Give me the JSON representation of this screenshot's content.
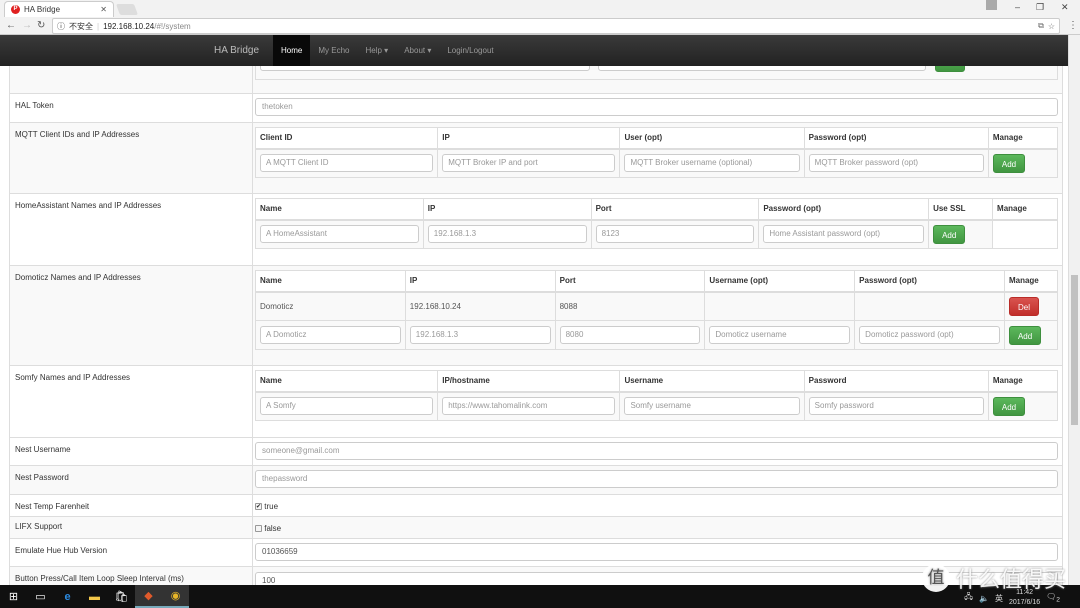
{
  "browser": {
    "tab_title": "HA Bridge",
    "security": "不安全",
    "url_host": "192.168.10.24",
    "url_path": "/#!/system"
  },
  "navbar": {
    "brand": "HA Bridge",
    "items": [
      "Home",
      "My Echo",
      "Help ▾",
      "About ▾",
      "Login/Logout"
    ],
    "active": "Home"
  },
  "settings": {
    "hal_token": {
      "label": "HAL Token",
      "placeholder": "thetoken"
    },
    "mqtt": {
      "label": "MQTT Client IDs and IP Addresses",
      "headers": [
        "Client ID",
        "IP",
        "User (opt)",
        "Password (opt)",
        "Manage"
      ],
      "placeholders": [
        "A MQTT Client ID",
        "MQTT Broker IP and port",
        "MQTT Broker username (optional)",
        "MQTT Broker password (opt)"
      ],
      "add": "Add"
    },
    "homeassistant": {
      "label": "HomeAssistant Names and IP Addresses",
      "headers": [
        "Name",
        "IP",
        "Port",
        "Password (opt)",
        "Use SSL",
        "Manage"
      ],
      "placeholders": [
        "A HomeAssistant",
        "192.168.1.3",
        "8123",
        "Home Assistant password (opt)"
      ],
      "use_ssl": false,
      "add": "Add"
    },
    "domoticz": {
      "label": "Domoticz Names and IP Addresses",
      "headers": [
        "Name",
        "IP",
        "Port",
        "Username (opt)",
        "Password (opt)",
        "Manage"
      ],
      "rows": [
        [
          "Domoticz",
          "192.168.10.24",
          "8088",
          "",
          ""
        ]
      ],
      "del": "Del",
      "placeholders": [
        "A Domoticz",
        "192.168.1.3",
        "8080",
        "Domoticz username",
        "Domoticz password (opt)"
      ],
      "add": "Add"
    },
    "somfy": {
      "label": "Somfy Names and IP Addresses",
      "headers": [
        "Name",
        "IP/hostname",
        "Username",
        "Password",
        "Manage"
      ],
      "placeholders": [
        "A Somfy",
        "https://www.tahomalink.com",
        "Somfy username",
        "Somfy password"
      ],
      "add": "Add"
    },
    "nest_username": {
      "label": "Nest Username",
      "placeholder": "someone@gmail.com"
    },
    "nest_password": {
      "label": "Nest Password",
      "placeholder": "thepassword"
    },
    "nest_temp_f": {
      "label": "Nest Temp Farenheit",
      "checked": true,
      "text": "true"
    },
    "lifx": {
      "label": "LIFX Support",
      "checked": false,
      "text": "false"
    },
    "hue_version": {
      "label": "Emulate Hue Hub Version",
      "value": "01036659"
    },
    "sleep_interval": {
      "label": "Button Press/Call Item Loop Sleep Interval (ms)",
      "value": "100"
    }
  },
  "tray": {
    "ime": "英",
    "time": "11:42",
    "date": "2017/6/16",
    "notifications": "2"
  },
  "watermark": {
    "text": "什么值得买",
    "mark": "值"
  }
}
